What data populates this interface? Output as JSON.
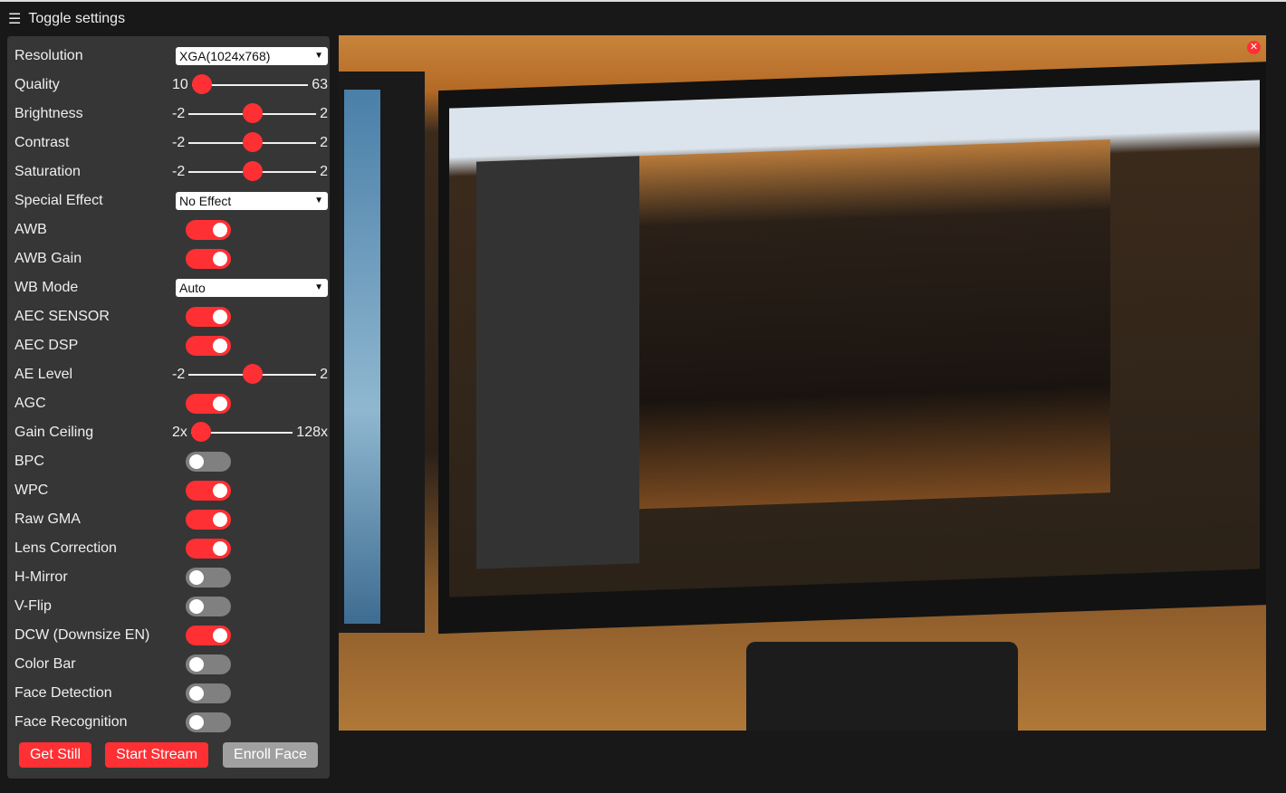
{
  "header": {
    "icon": "hamburger-icon",
    "title": "Toggle settings"
  },
  "controls": [
    {
      "label": "Resolution",
      "type": "select",
      "value": "XGA(1024x768)"
    },
    {
      "label": "Quality",
      "type": "slider",
      "min": "10",
      "max": "63",
      "value": 10,
      "range": [
        10,
        63
      ]
    },
    {
      "label": "Brightness",
      "type": "slider",
      "min": "-2",
      "max": "2",
      "value": 0,
      "range": [
        -2,
        2
      ]
    },
    {
      "label": "Contrast",
      "type": "slider",
      "min": "-2",
      "max": "2",
      "value": 0,
      "range": [
        -2,
        2
      ]
    },
    {
      "label": "Saturation",
      "type": "slider",
      "min": "-2",
      "max": "2",
      "value": 0,
      "range": [
        -2,
        2
      ]
    },
    {
      "label": "Special Effect",
      "type": "select",
      "value": "No Effect"
    },
    {
      "label": "AWB",
      "type": "toggle",
      "on": true
    },
    {
      "label": "AWB Gain",
      "type": "toggle",
      "on": true
    },
    {
      "label": "WB Mode",
      "type": "select",
      "value": "Auto"
    },
    {
      "label": "AEC SENSOR",
      "type": "toggle",
      "on": true
    },
    {
      "label": "AEC DSP",
      "type": "toggle",
      "on": true
    },
    {
      "label": "AE Level",
      "type": "slider",
      "min": "-2",
      "max": "2",
      "value": 0,
      "range": [
        -2,
        2
      ]
    },
    {
      "label": "AGC",
      "type": "toggle",
      "on": true
    },
    {
      "label": "Gain Ceiling",
      "type": "slider",
      "min": "2x",
      "max": "128x",
      "value": 0,
      "range": [
        0,
        6
      ]
    },
    {
      "label": "BPC",
      "type": "toggle",
      "on": false
    },
    {
      "label": "WPC",
      "type": "toggle",
      "on": true
    },
    {
      "label": "Raw GMA",
      "type": "toggle",
      "on": true
    },
    {
      "label": "Lens Correction",
      "type": "toggle",
      "on": true
    },
    {
      "label": "H-Mirror",
      "type": "toggle",
      "on": false
    },
    {
      "label": "V-Flip",
      "type": "toggle",
      "on": false
    },
    {
      "label": "DCW (Downsize EN)",
      "type": "toggle",
      "on": true
    },
    {
      "label": "Color Bar",
      "type": "toggle",
      "on": false
    },
    {
      "label": "Face Detection",
      "type": "toggle",
      "on": false
    },
    {
      "label": "Face Recognition",
      "type": "toggle",
      "on": false
    }
  ],
  "buttons": {
    "get_still": "Get Still",
    "start_stream": "Start Stream",
    "enroll_face": "Enroll Face"
  },
  "stream": {
    "close_icon": "close-icon",
    "close_glyph": "✕"
  },
  "colors": {
    "accent": "#ff3034",
    "panel": "#363636",
    "background": "#181818",
    "toggle_off": "#808080"
  }
}
